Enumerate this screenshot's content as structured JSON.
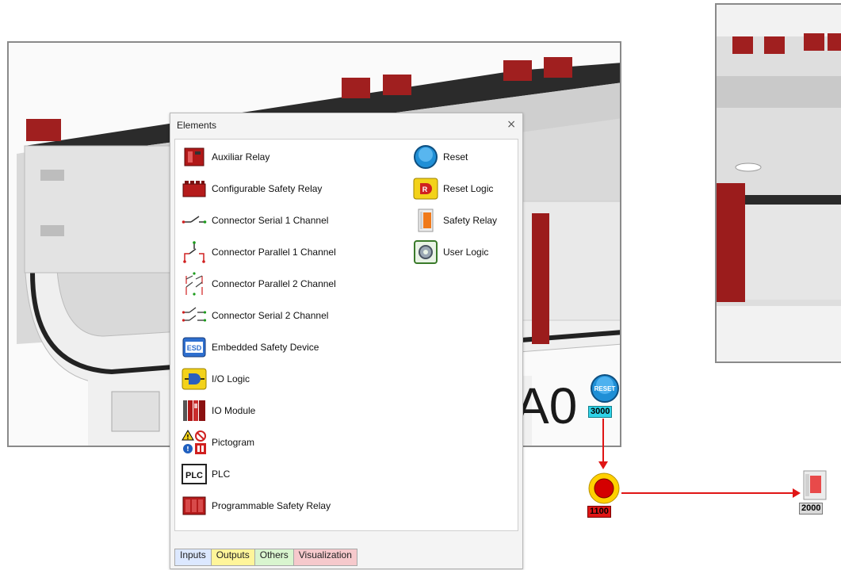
{
  "palette": {
    "title": "Elements",
    "close_glyph": "×",
    "scroll_left": "<",
    "scroll_right": ">",
    "items_left": [
      {
        "label": "Auxiliar Relay",
        "icon": "auxiliar-relay-icon"
      },
      {
        "label": "Configurable Safety Relay",
        "icon": "configurable-safety-relay-icon"
      },
      {
        "label": "Connector Serial 1 Channel",
        "icon": "connector-serial-1-icon"
      },
      {
        "label": "Connector Parallel 1 Channel",
        "icon": "connector-parallel-1-icon"
      },
      {
        "label": "Connector Parallel 2 Channel",
        "icon": "connector-parallel-2-icon"
      },
      {
        "label": "Connector Serial 2 Channel",
        "icon": "connector-serial-2-icon"
      },
      {
        "label": "Embedded Safety Device",
        "icon": "embedded-safety-device-icon",
        "icon_text": "ESD"
      },
      {
        "label": "I/O Logic",
        "icon": "io-logic-icon"
      },
      {
        "label": "IO Module",
        "icon": "io-module-icon"
      },
      {
        "label": "Pictogram",
        "icon": "pictogram-icon"
      },
      {
        "label": "PLC",
        "icon": "plc-icon",
        "icon_text": "PLC"
      },
      {
        "label": "Programmable Safety Relay",
        "icon": "programmable-safety-relay-icon"
      }
    ],
    "items_right": [
      {
        "label": "Reset",
        "icon": "reset-icon"
      },
      {
        "label": "Reset Logic",
        "icon": "reset-logic-icon",
        "icon_text": "R"
      },
      {
        "label": "Safety Relay",
        "icon": "safety-relay-icon"
      },
      {
        "label": "User Logic",
        "icon": "user-logic-icon"
      }
    ],
    "tabs": [
      {
        "label": "Inputs",
        "color": "#dce8ff"
      },
      {
        "label": "Outputs",
        "color": "#fff59a"
      },
      {
        "label": "Others",
        "color": "#d9f5cf"
      },
      {
        "label": "Visualization",
        "color": "#f6c9cc"
      }
    ]
  },
  "canvas": {
    "area_label": "A0",
    "nodes": [
      {
        "id": "3000",
        "type": "reset",
        "icon_text": "RESET",
        "tag_color": "#2fd3e8"
      },
      {
        "id": "1100",
        "type": "emergency-stop",
        "tag_color": "#e01515"
      },
      {
        "id": "2000",
        "type": "safety-relay",
        "tag_color": "#d9d9d9"
      }
    ],
    "connection_color": "#e01515"
  }
}
